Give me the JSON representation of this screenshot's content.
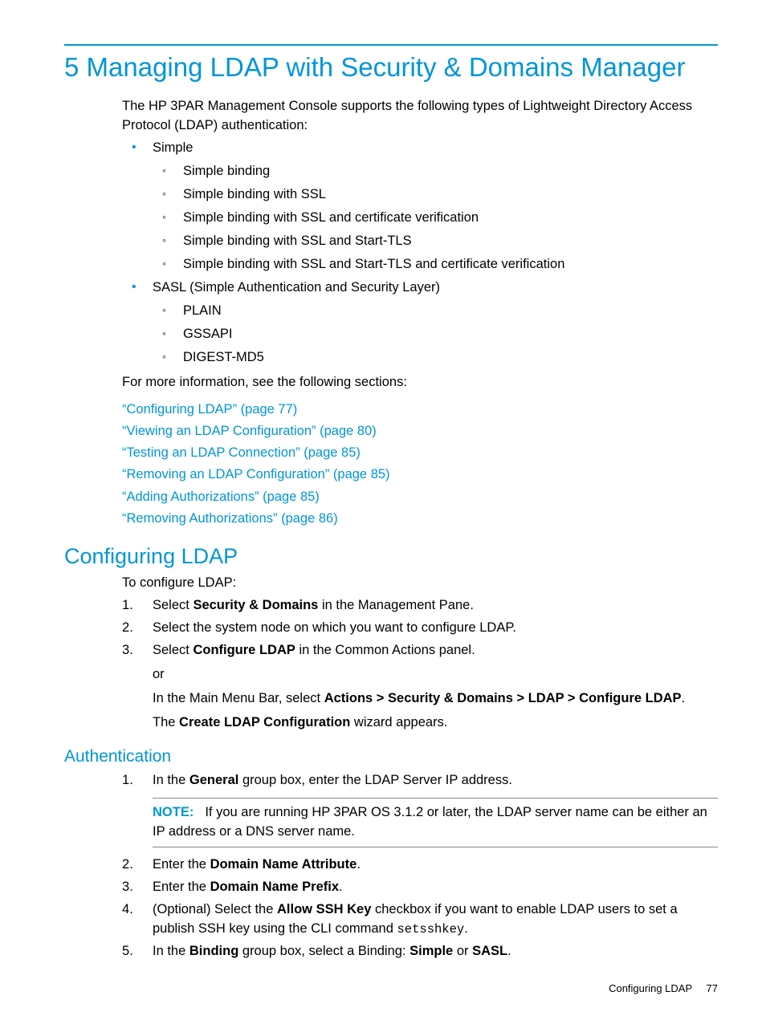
{
  "chapter": {
    "title": "5 Managing LDAP with Security & Domains Manager",
    "intro": "The HP 3PAR Management Console supports the following types of Lightweight Directory Access Protocol (LDAP) authentication:"
  },
  "list1": {
    "item1": {
      "label": "Simple",
      "sub": [
        "Simple binding",
        "Simple binding with SSL",
        "Simple binding with SSL and certificate verification",
        "Simple binding with SSL and Start-TLS",
        "Simple binding with SSL and Start-TLS and certificate verification"
      ]
    },
    "item2": {
      "label": "SASL (Simple Authentication and Security Layer)",
      "sub": [
        "PLAIN",
        "GSSAPI",
        "DIGEST-MD5"
      ]
    }
  },
  "moreinfo": "For more information, see the following sections:",
  "refs": [
    "“Configuring LDAP” (page 77)",
    "“Viewing an LDAP Configuration” (page 80)",
    "“Testing an LDAP Connection” (page 85)",
    "“Removing an LDAP Configuration” (page 85)",
    "“Adding Authorizations” (page 85)",
    "“Removing Authorizations” (page 86)"
  ],
  "section1": {
    "title": "Configuring LDAP",
    "intro": "To configure LDAP:",
    "steps": [
      {
        "pre": "Select",
        "bold": "Security & Domains",
        "post": "in the Management Pane."
      },
      {
        "text": "Select the system node on which you want to configure LDAP."
      },
      {
        "pre": "Select",
        "bold": "Configure LDAP",
        "post": "in the Common Actions panel.",
        "or": "or",
        "alt_pre": "In the Main Menu Bar, select",
        "alt_bold": "Actions > Security & Domains > LDAP > Configure LDAP",
        "alt_post": ".",
        "result_pre": "The",
        "result_bold": "Create LDAP Configuration",
        "result_post": "wizard appears."
      }
    ]
  },
  "section2": {
    "title": "Authentication",
    "note": {
      "label": "NOTE:",
      "text": "If you are running HP 3PAR OS 3.1.2 or later, the LDAP server name can be either an IP address or a DNS server name."
    },
    "steps": [
      {
        "pre": "In the",
        "bold": "General",
        "post": "group box, enter the LDAP Server IP address."
      },
      {
        "pre": "Enter the",
        "bold": "Domain Name Attribute",
        "post": "."
      },
      {
        "pre": "Enter the",
        "bold": "Domain Name Prefix",
        "post": "."
      },
      {
        "pre": "(Optional) Select the",
        "bold": "Allow SSH Key",
        "mid": "checkbox if you want to enable LDAP users to set a publish SSH key using the CLI command",
        "code": "setsshkey",
        "post": "."
      },
      {
        "pre": "In the",
        "bold1": "Binding",
        "mid": "group box, select a Binding:",
        "bold2": "Simple",
        "or": "or",
        "bold3": "SASL",
        "post": "."
      }
    ]
  },
  "footer": {
    "section": "Configuring LDAP",
    "page": "77"
  }
}
